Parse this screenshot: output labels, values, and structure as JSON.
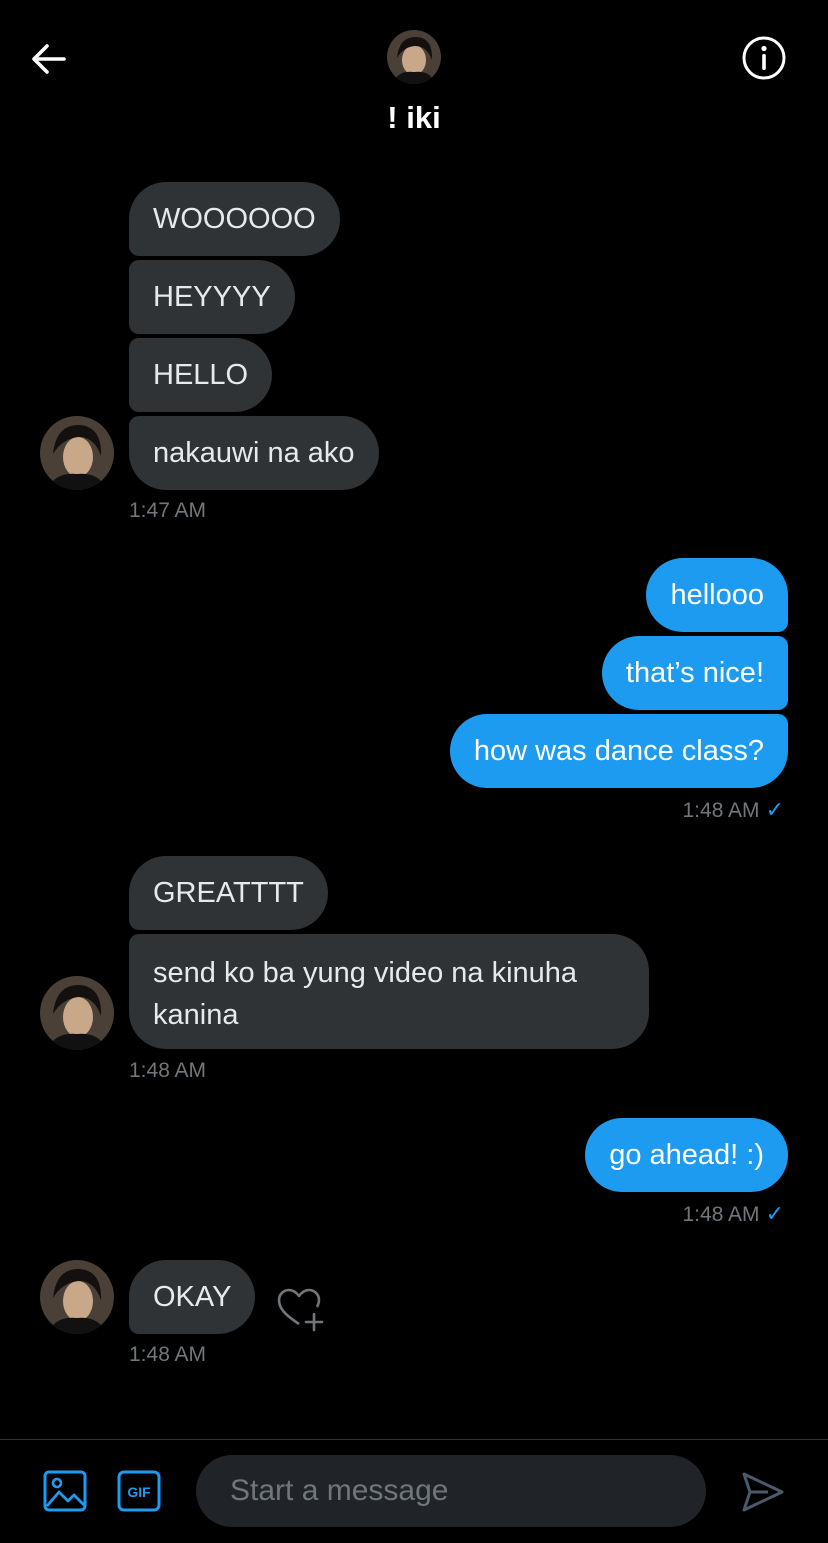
{
  "header": {
    "title": "! iki",
    "back_icon": "arrow-left-icon",
    "info_icon": "info-circle-icon"
  },
  "messages": [
    {
      "text": "WOOOOOO"
    },
    {
      "text": "HEYYYY"
    },
    {
      "text": "HELLO"
    },
    {
      "text": "nakauwi na ako"
    },
    {
      "text": "hellooo"
    },
    {
      "text": "that’s nice!"
    },
    {
      "text": "how was dance class?"
    },
    {
      "text": "GREATTTT"
    },
    {
      "text": "send ko ba yung video na kinuha kanina"
    },
    {
      "text": "go ahead! :)"
    },
    {
      "text": "OKAY"
    }
  ],
  "timestamps": [
    "1:47 AM",
    "1:48 AM",
    "1:48 AM",
    "1:48 AM",
    "1:48 AM"
  ],
  "composer": {
    "placeholder": "Start a message",
    "gif_label": "GIF"
  },
  "colors": {
    "background": "#000000",
    "incoming_bubble": "#2f3336",
    "outgoing_bubble": "#1d9bf0",
    "accent": "#1d9bf0",
    "muted_text": "#71767b"
  }
}
